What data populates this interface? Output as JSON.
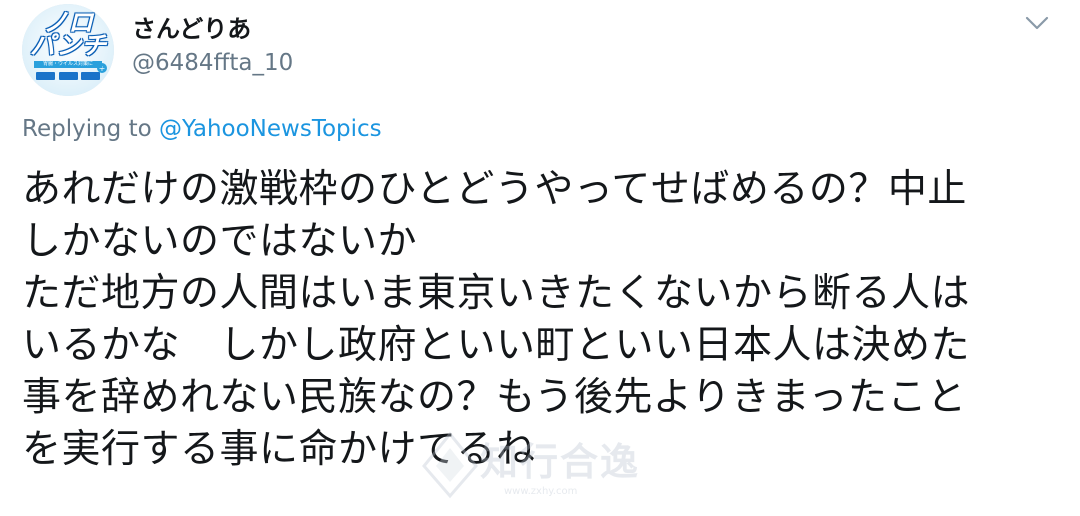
{
  "user": {
    "display_name": "さんどりあ",
    "handle": "@6484ffta_10",
    "avatar": {
      "line1": "ノロ",
      "line2": "パンチ",
      "subtitle": "胃腸・ウイルス対策に",
      "brand_color": "#1a73c9",
      "accent_color": "#2aa0dc"
    }
  },
  "reply": {
    "prefix": "Replying to ",
    "mention": "@YahooNewsTopics"
  },
  "tweet": {
    "lines": [
      "あれだけの激戦枠のひとどうやってせばめるの？中止",
      "しかないのではないか",
      "ただ地方の人間はいま東京いきたくないから断る人は",
      "いるかな　しかし政府といい町といい日本人は決めた",
      "事を辞めれない民族なの？もう後先よりきまったこと",
      "を実行する事に命かけてるね"
    ]
  },
  "icons": {
    "menu": "chevron-down-icon"
  },
  "colors": {
    "text": "#14171a",
    "secondary": "#657786",
    "link": "#1b95e0",
    "background": "#ffffff"
  },
  "watermark": {
    "text": "知行合逸",
    "url": "www.zxhy.com"
  }
}
